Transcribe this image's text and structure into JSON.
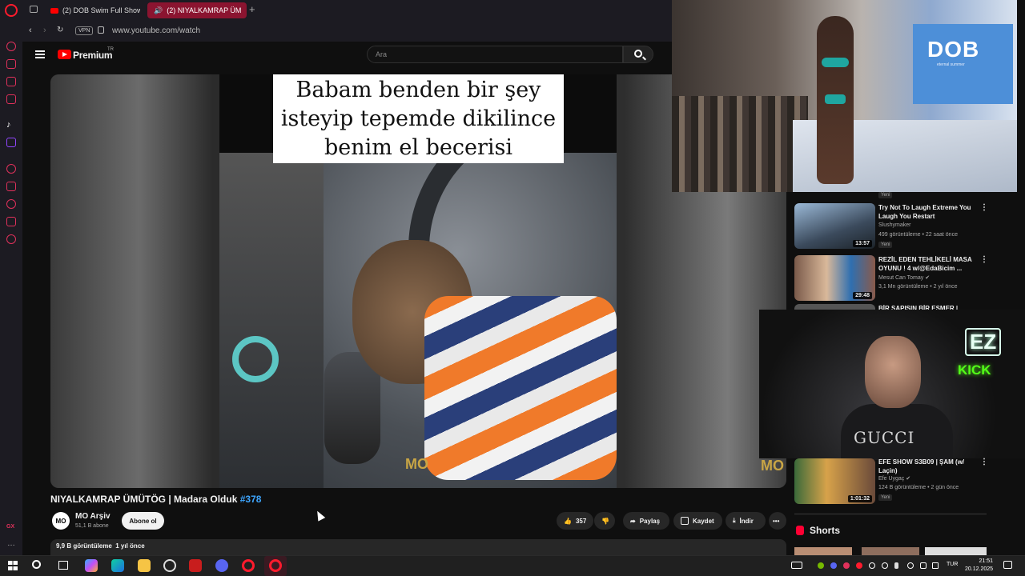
{
  "browser": {
    "tabs": [
      {
        "label": "(2) DOB Swim Full Show"
      },
      {
        "label": "(2) NIYALKAMRAP ÜM"
      }
    ],
    "new_tab_glyph": "+",
    "vpn_badge": "VPN",
    "url": "www.youtube.com/watch"
  },
  "youtube": {
    "brand": "Premium",
    "region": "TR",
    "search_placeholder": "Ara"
  },
  "video": {
    "caption": [
      "Babam benden bir şey",
      "isteyip tepemde dikilince",
      "benim el becerisi"
    ],
    "title": "NIYALKAMRAP ÜMÜTÖG | Madara Olduk ",
    "title_tag": "#378",
    "watermark": "MO",
    "channel": {
      "avatar": "MO",
      "name": "MO Arşiv",
      "subs": "51,1 B abone"
    },
    "subscribe_label": "Abone ol",
    "likes": "357",
    "actions": {
      "share": "Paylaş",
      "save": "Kaydet",
      "download": "İndir"
    },
    "views": "9,9 B görüntüleme",
    "age": "1 yıl önce"
  },
  "overlay": {
    "runway_brand": "DOB",
    "runway_sub": "eternal summer",
    "cam_logo_top": "EZ",
    "cam_logo_bottom": "KICK",
    "shirt_text": "GUCCI"
  },
  "recommendations": {
    "first_badge": "Yeni",
    "items": [
      {
        "title": "Try Not To Laugh Extreme You Laugh You Restart",
        "channel": "Slushymaker",
        "meta": "499 görüntüleme • 22 saat önce",
        "duration": "13:57",
        "badge": "Yeni"
      },
      {
        "title": "REZİL EDEN TEHLİKELİ MASA OYUNU ! 4 w/@EdaBicim ...",
        "channel": "Mesut Can Tomay ✔",
        "meta": "3,1 Mn görüntüleme • 2 yıl önce",
        "duration": "29:48",
        "badge": ""
      },
      {
        "title": "BİR SAPIŞIN BİR EŞMER |",
        "channel": "",
        "meta": "",
        "duration": "",
        "badge": ""
      },
      {
        "title": "EFE SHOW S3B09 | ŞAM (w/ Laçin)",
        "channel": "Efe Uygaç ✔",
        "meta": "124 B görüntüleme • 2 gün önce",
        "duration": "1:01:32",
        "badge": "Yeni"
      }
    ],
    "more_glyph": "⋮"
  },
  "shorts_label": "Shorts",
  "taskbar": {
    "language": "TUR",
    "time": "21:51",
    "date": "20.12.2025"
  },
  "colors": {
    "accent": "#ff0000",
    "opera": "#ff1b2d",
    "link": "#3ea6ff",
    "kick": "#53fc18"
  }
}
